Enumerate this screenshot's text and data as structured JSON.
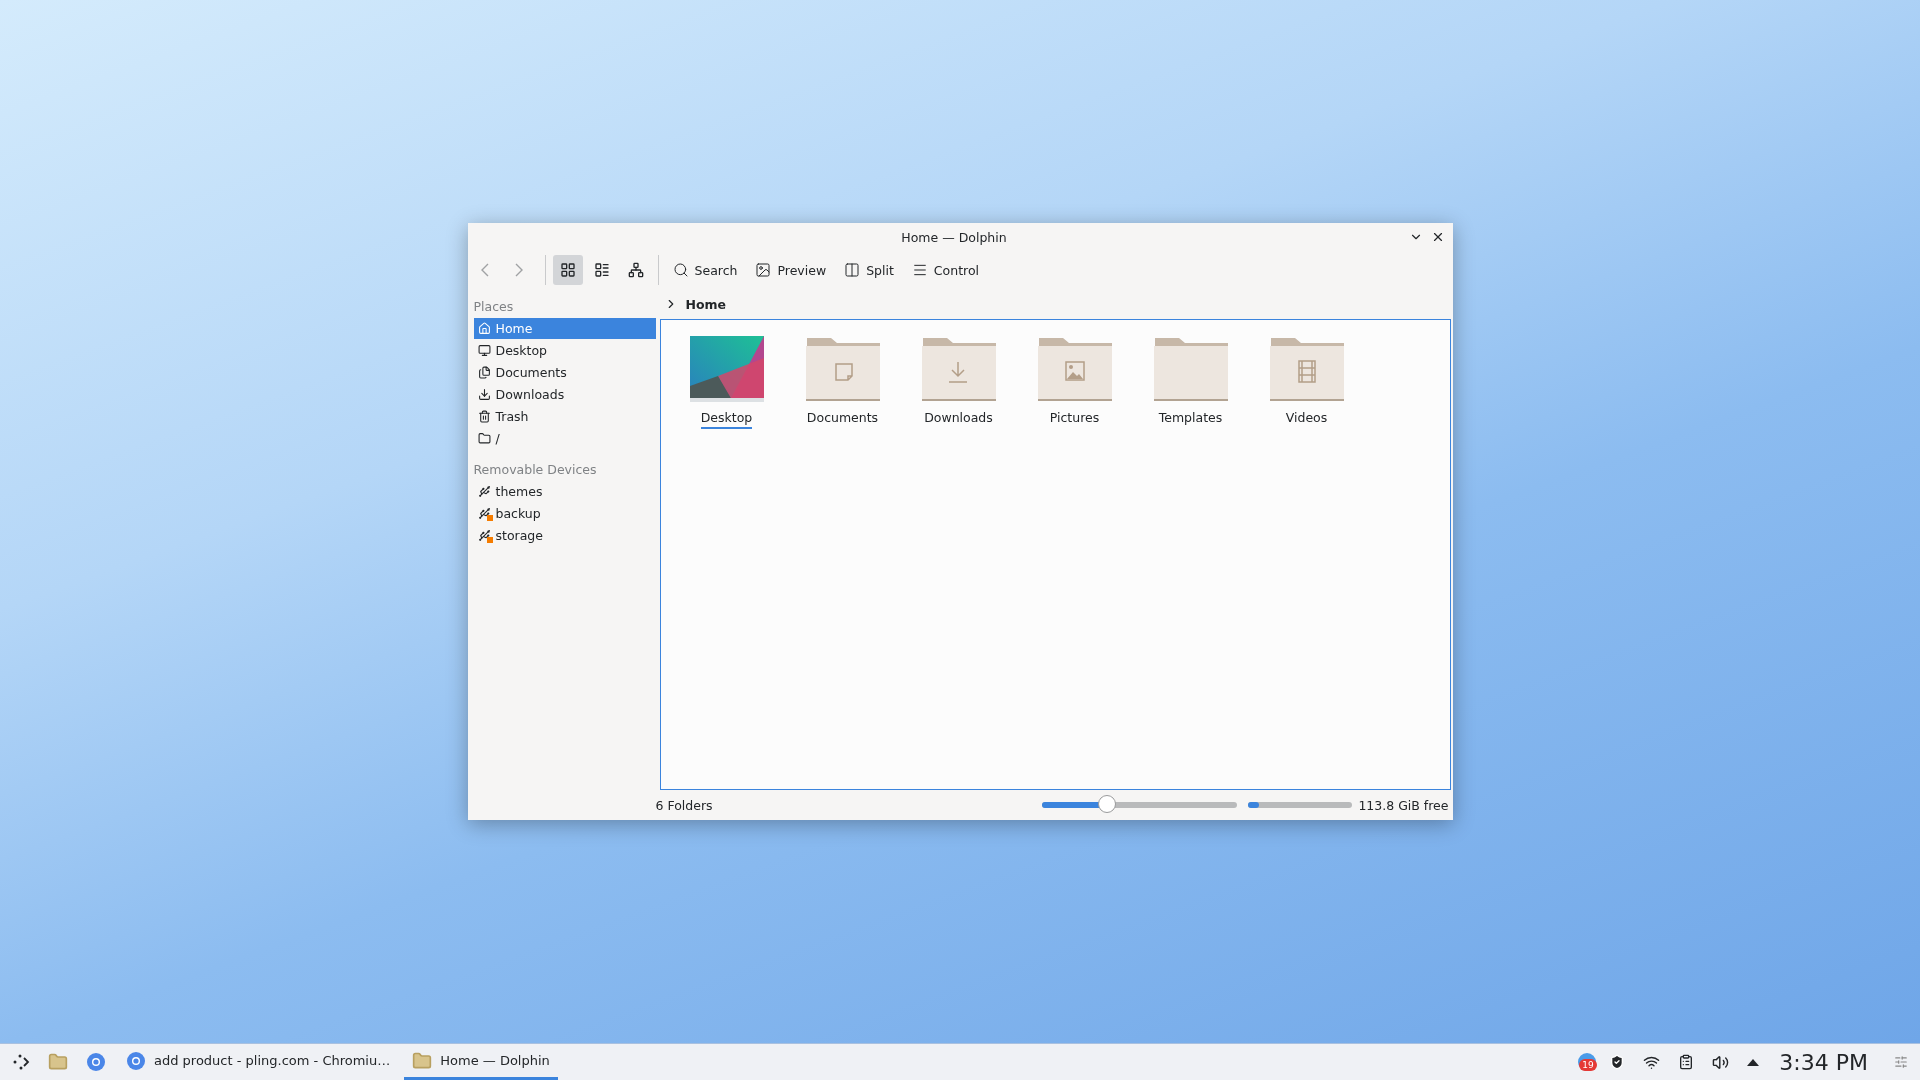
{
  "window": {
    "title": "Home — Dolphin"
  },
  "toolbar": {
    "view_modes": [
      {
        "kind": "icons",
        "selected": true
      },
      {
        "kind": "details",
        "selected": false
      },
      {
        "kind": "tree",
        "selected": false
      }
    ],
    "actions": [
      {
        "kind": "search",
        "label": "Search"
      },
      {
        "kind": "preview",
        "label": "Preview"
      },
      {
        "kind": "split",
        "label": "Split"
      },
      {
        "kind": "menu",
        "label": "Control"
      }
    ]
  },
  "sidebar": {
    "sections": [
      {
        "title": "Places",
        "items": [
          {
            "kind": "home",
            "label": "Home",
            "selected": true
          },
          {
            "kind": "desktop",
            "label": "Desktop",
            "selected": false
          },
          {
            "kind": "documents",
            "label": "Documents",
            "selected": false
          },
          {
            "kind": "downloads",
            "label": "Downloads",
            "selected": false
          },
          {
            "kind": "trash",
            "label": "Trash",
            "selected": false
          },
          {
            "kind": "folder",
            "label": "/",
            "selected": false
          }
        ]
      },
      {
        "title": "Removable Devices",
        "items": [
          {
            "kind": "drive",
            "label": "themes",
            "selected": false
          },
          {
            "kind": "drive-alert",
            "label": "backup",
            "selected": false
          },
          {
            "kind": "drive-alert",
            "label": "storage",
            "selected": false
          }
        ]
      }
    ]
  },
  "breadcrumb": {
    "path": "Home"
  },
  "files": [
    {
      "kind": "wallpaper",
      "name": "Desktop",
      "focused": true
    },
    {
      "kind": "documents",
      "name": "Documents",
      "focused": false
    },
    {
      "kind": "downloads",
      "name": "Downloads",
      "focused": false
    },
    {
      "kind": "pictures",
      "name": "Pictures",
      "focused": false
    },
    {
      "kind": "plain",
      "name": "Templates",
      "focused": false
    },
    {
      "kind": "videos",
      "name": "Videos",
      "focused": false
    }
  ],
  "status_bar": {
    "text": "6 Folders",
    "zoom": {
      "level": 0.33
    },
    "disk": {
      "level": 0.1
    },
    "free": "113.8 GiB free"
  },
  "taskbar": {
    "tasks": [
      {
        "kind": "browser",
        "label": "add product - pling.com - Chromiu…",
        "selected": false
      },
      {
        "kind": "folder",
        "label": "Home — Dolphin",
        "selected": true
      }
    ],
    "notification_count": "19",
    "clock": "3:34 PM"
  }
}
